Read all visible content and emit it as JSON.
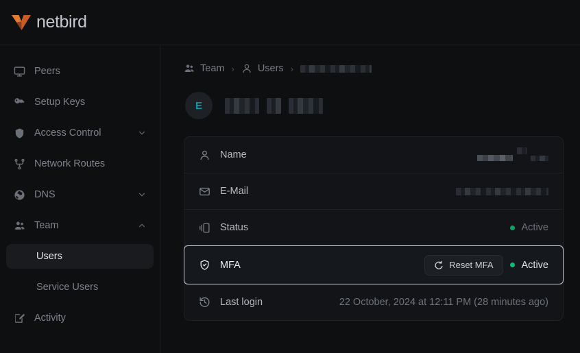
{
  "brand": {
    "name": "netbird",
    "logo_icon": "netbird-logo-icon",
    "logo_color": "#c75c28"
  },
  "sidebar": {
    "items": [
      {
        "label": "Peers",
        "icon": "monitor-icon",
        "chevron": null,
        "active": false
      },
      {
        "label": "Setup Keys",
        "icon": "key-icon",
        "chevron": null,
        "active": false
      },
      {
        "label": "Access Control",
        "icon": "shield-icon",
        "chevron": "down",
        "active": false
      },
      {
        "label": "Network Routes",
        "icon": "network-routes-icon",
        "chevron": null,
        "active": false
      },
      {
        "label": "DNS",
        "icon": "globe-icon",
        "chevron": "down",
        "active": false
      },
      {
        "label": "Team",
        "icon": "users-icon",
        "chevron": "up",
        "active": false
      }
    ],
    "team_children": [
      {
        "label": "Users",
        "active": true
      },
      {
        "label": "Service Users",
        "active": false
      }
    ],
    "bottom_items": [
      {
        "label": "Activity",
        "icon": "activity-edit-icon",
        "chevron": null,
        "active": false
      }
    ]
  },
  "breadcrumb": {
    "items": [
      {
        "label": "Team",
        "icon": "users-icon",
        "redacted": false
      },
      {
        "label": "Users",
        "icon": "person-icon",
        "redacted": false
      },
      {
        "label": "",
        "icon": null,
        "redacted": true
      }
    ],
    "separator": "›"
  },
  "user_header": {
    "avatar_initial": "E",
    "avatar_text_color": "#0d9aa8",
    "name_redacted": true
  },
  "details": {
    "rows": [
      {
        "label": "Name",
        "icon": "person-icon",
        "value_type": "redacted",
        "value": "",
        "focused": false
      },
      {
        "label": "E-Mail",
        "icon": "envelope-icon",
        "value_type": "redacted",
        "value": "",
        "focused": false
      },
      {
        "label": "Status",
        "icon": "contrast-icon",
        "value_type": "status",
        "value": "Active",
        "status_color": "#14a06a",
        "focused": false
      },
      {
        "label": "MFA",
        "icon": "shield-check-icon",
        "value_type": "status_with_button",
        "value": "Active",
        "status_color": "#12b97a",
        "button_label": "Reset MFA",
        "button_icon": "refresh-ccw-icon",
        "focused": true
      },
      {
        "label": "Last login",
        "icon": "history-icon",
        "value_type": "text",
        "value": "22 October, 2024 at 12:11 PM (28 minutes ago)",
        "focused": false
      }
    ]
  },
  "colors": {
    "background": "#0e0f11",
    "card_background": "#121417",
    "border": "#1e2125",
    "accent_orange": "#c75c28",
    "accent_teal": "#0d9aa8",
    "status_green": "#12b97a",
    "focus_border": "#c9ccd2"
  }
}
